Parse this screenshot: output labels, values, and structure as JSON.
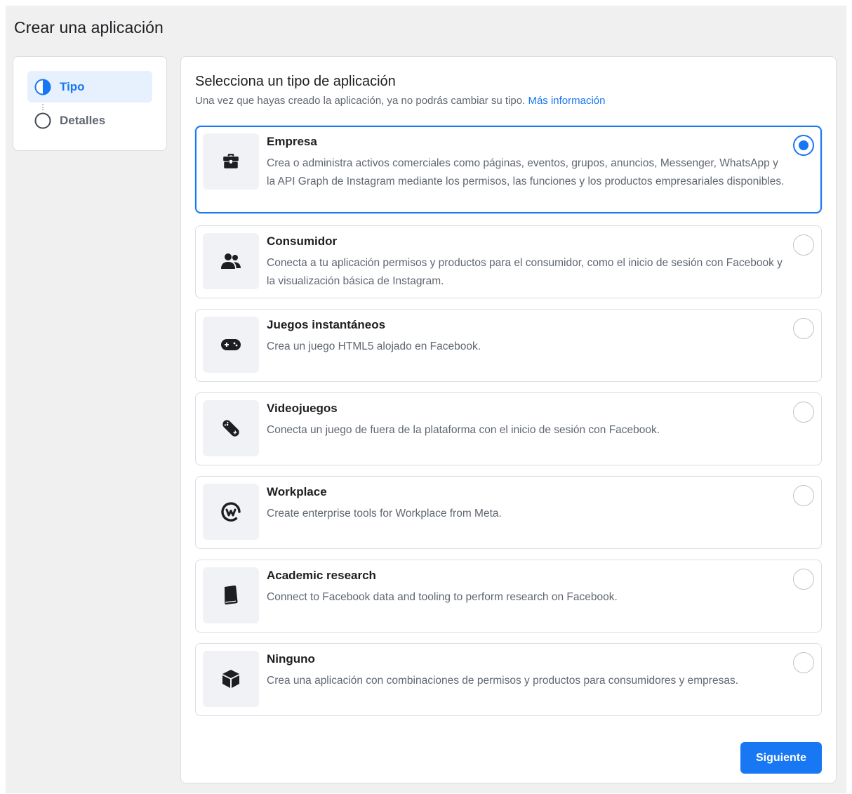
{
  "page": {
    "title": "Crear una aplicación"
  },
  "steps": [
    {
      "label": "Tipo",
      "state": "active",
      "icon": "half-circle-icon"
    },
    {
      "label": "Detalles",
      "state": "inactive",
      "icon": "circle-outline-icon"
    }
  ],
  "panel": {
    "heading": "Selecciona un tipo de aplicación",
    "subtitle": "Una vez que hayas creado la aplicación, ya no podrás cambiar su tipo.",
    "more_link": "Más información"
  },
  "options": [
    {
      "title": "Empresa",
      "icon": "briefcase-icon",
      "selected": true,
      "description": "Crea o administra activos comerciales como páginas, eventos, grupos, anuncios, Messenger, WhatsApp y la API Graph de Instagram mediante los permisos, las funciones y los productos empresariales disponibles."
    },
    {
      "title": "Consumidor",
      "icon": "people-icon",
      "selected": false,
      "description": "Conecta a tu aplicación permisos y productos para el consumidor, como el inicio de sesión con Facebook y la visualización básica de Instagram."
    },
    {
      "title": "Juegos instantáneos",
      "icon": "gamepad-icon",
      "selected": false,
      "description": "Crea un juego HTML5 alojado en Facebook."
    },
    {
      "title": "Videojuegos",
      "icon": "game-controller-tilted-icon",
      "selected": false,
      "description": "Conecta un juego de fuera de la plataforma con el inicio de sesión con Facebook."
    },
    {
      "title": "Workplace",
      "icon": "workplace-logo-icon",
      "selected": false,
      "description": "Create enterprise tools for Workplace from Meta."
    },
    {
      "title": "Academic research",
      "icon": "book-icon",
      "selected": false,
      "description": "Connect to Facebook data and tooling to perform research on Facebook."
    },
    {
      "title": "Ninguno",
      "icon": "cube-icon",
      "selected": false,
      "description": "Crea una aplicación con combinaciones de permisos y productos para consumidores y empresas."
    }
  ],
  "footer": {
    "next_label": "Siguiente"
  },
  "colors": {
    "accent": "#1877f2",
    "background": "#f0f0f0",
    "active_step_bg": "#e7f0fd"
  }
}
